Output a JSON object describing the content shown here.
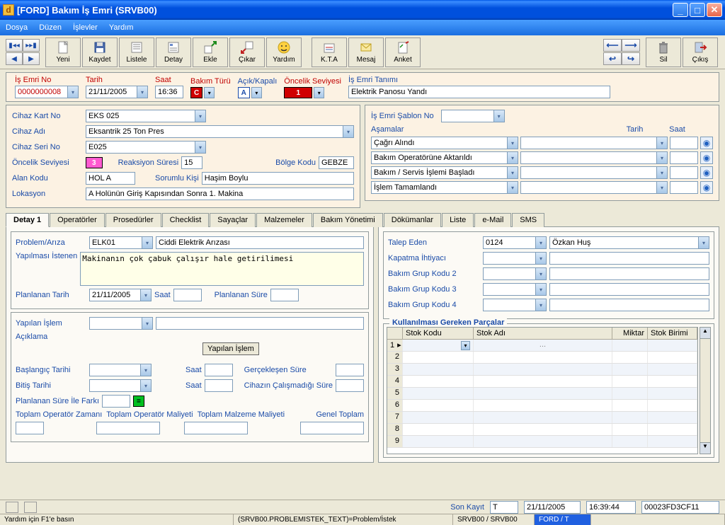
{
  "window": {
    "title": "[FORD] Bakım İş Emri (SRVB00)"
  },
  "menu": {
    "dosya": "Dosya",
    "duzen": "Düzen",
    "islevler": "İşlevler",
    "yardim": "Yardım"
  },
  "toolbar": {
    "yeni": "Yeni",
    "kaydet": "Kaydet",
    "listele": "Listele",
    "detay": "Detay",
    "ekle": "Ekle",
    "cikar": "Çıkar",
    "yardim": "Yardım",
    "kta": "K.T.A",
    "mesaj": "Mesaj",
    "anket": "Anket",
    "sil": "Sil",
    "cikis": "Çıkış"
  },
  "header": {
    "lbl_isemrino": "İş Emri No",
    "isemrino": "0000000008",
    "lbl_tarih": "Tarih",
    "tarih": "21/11/2005",
    "lbl_saat": "Saat",
    "saat": "16:36",
    "lbl_bakimturu": "Bakım Türü",
    "bakimturu": "C",
    "lbl_acikkapali": "Açık/Kapalı",
    "acikkapali": "A",
    "lbl_oncelik": "Öncelik Seviyesi",
    "oncelik": "1",
    "lbl_tanim": "İş Emri Tanımı",
    "tanim": "Elektrik Panosu Yandı"
  },
  "device": {
    "lbl_kartno": "Cihaz Kart No",
    "kartno": "EKS 025",
    "lbl_adi": "Cihaz Adı",
    "adi": "Eksantrik 25 Ton Pres",
    "lbl_serino": "Cihaz Seri No",
    "serino": "E025",
    "lbl_oncelik": "Öncelik Seviyesi",
    "oncelik": "3",
    "lbl_reaksiyon": "Reaksiyon Süresi",
    "reaksiyon": "15",
    "lbl_bolge": "Bölge Kodu",
    "bolge": "GEBZE",
    "lbl_alan": "Alan Kodu",
    "alan": "HOL A",
    "lbl_sorumlu": "Sorumlu Kişi",
    "sorumlu": "Haşim Boylu",
    "lbl_lokasyon": "Lokasyon",
    "lokasyon": "A Holünün Giriş Kapısından Sonra 1. Makina"
  },
  "template": {
    "lbl": "İş Emri Şablon No",
    "lbl_asamalar": "Aşamalar",
    "lbl_tarih": "Tarih",
    "lbl_saat": "Saat",
    "stages": [
      "Çağrı Alındı",
      "Bakım Operatörüne Aktarıldı",
      "Bakım / Servis İşlemi Başladı",
      "İşlem Tamamlandı"
    ]
  },
  "tabs": {
    "detay1": "Detay 1",
    "operatorler": "Operatörler",
    "prosedurler": "Prosedürler",
    "checklist": "Checklist",
    "sayaclar": "Sayaçlar",
    "malzemeler": "Malzemeler",
    "bakimyonetimi": "Bakım Yönetimi",
    "dokumanlar": "Dökümanlar",
    "liste": "Liste",
    "email": "e-Mail",
    "sms": "SMS"
  },
  "detail": {
    "lbl_problem": "Problem/Arıza",
    "problem_code": "ELK01",
    "problem_text": "Ciddi Elektrik Arızası",
    "lbl_istenen": "Yapılması İstenen",
    "istenen": "Makinanın çok çabuk çalışır hale getirilimesi",
    "lbl_plantarih": "Planlanan Tarih",
    "plantarih": "21/11/2005",
    "lbl_saat": "Saat",
    "lbl_plansure": "Planlanan Süre",
    "lbl_yapilan": "Yapılan İşlem",
    "lbl_aciklama": "Açıklama",
    "btn_yapilan": "Yapılan İşlem",
    "lbl_baslangic": "Başlangıç Tarihi",
    "lbl_bitis": "Bitiş Tarihi",
    "lbl_gerceklesen": "Gerçekleşen Süre",
    "lbl_calismadigi": "Cihazın Çalışmadığı Süre",
    "lbl_fark": "Planlanan Süre İle Farkı",
    "lbl_topop": "Toplam Operatör Zamanı",
    "lbl_topopm": "Toplam Operatör Maliyeti",
    "lbl_topmal": "Toplam Malzeme Maliyeti",
    "lbl_genel": "Genel Toplam"
  },
  "request": {
    "lbl_talep": "Talep Eden",
    "talep_code": "0124",
    "talep_name": "Özkan Huş",
    "lbl_kapatma": "Kapatma İhtiyacı",
    "lbl_grup2": "Bakım Grup Kodu 2",
    "lbl_grup3": "Bakım Grup Kodu 3",
    "lbl_grup4": "Bakım Grup Kodu 4"
  },
  "parts": {
    "legend": "Kullanılması Gereken Parçalar",
    "h_stokkodu": "Stok Kodu",
    "h_stokadi": "Stok Adı",
    "h_miktar": "Miktar",
    "h_birim": "Stok Birimi"
  },
  "footer": {
    "lbl_sonkayit": "Son Kayıt",
    "sk_user": "T",
    "sk_date": "21/11/2005",
    "sk_time": "16:39:44",
    "sk_id": "00023FD3CF11"
  },
  "status": {
    "help": "Yardım için F1'e basın",
    "field": "(SRVB00.PROBLEMISTEK_TEXT)=Problem/İstek",
    "module": "SRVB00 / SRVB00",
    "company": "FORD / T"
  }
}
